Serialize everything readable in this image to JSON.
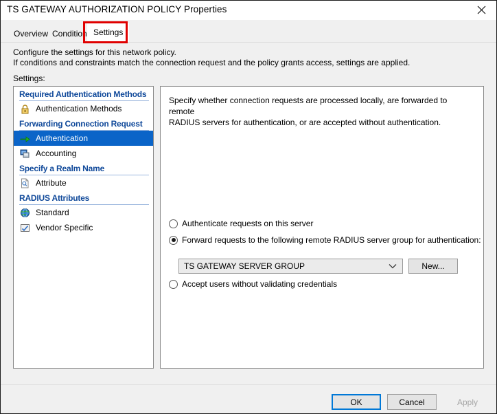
{
  "window": {
    "title": "TS GATEWAY AUTHORIZATION POLICY Properties",
    "close_icon": "close-icon"
  },
  "tabs": [
    {
      "label": "Overview",
      "active": false
    },
    {
      "label": "Conditions",
      "active": false
    },
    {
      "label": "Settings",
      "active": true
    }
  ],
  "description": {
    "line1": "Configure the settings for this network policy.",
    "line2": "If conditions and constraints match the connection request and the policy grants access, settings are applied.",
    "settings_label": "Settings:"
  },
  "settings_tree": {
    "groups": [
      {
        "header": "Required Authentication Methods",
        "items": [
          {
            "label": "Authentication Methods",
            "icon": "padlock-icon",
            "selected": false
          }
        ]
      },
      {
        "header": "Forwarding Connection Request",
        "items": [
          {
            "label": "Authentication",
            "icon": "green-arrow-icon",
            "selected": true
          },
          {
            "label": "Accounting",
            "icon": "computer-icon",
            "selected": false
          }
        ]
      },
      {
        "header": "Specify a Realm Name",
        "items": [
          {
            "label": "Attribute",
            "icon": "document-search-icon",
            "selected": false
          }
        ]
      },
      {
        "header": "RADIUS Attributes",
        "items": [
          {
            "label": "Standard",
            "icon": "globe-icon",
            "selected": false
          },
          {
            "label": "Vendor Specific",
            "icon": "form-check-icon",
            "selected": false
          }
        ]
      }
    ]
  },
  "content": {
    "description_line1": "Specify whether connection requests are processed locally, are forwarded to remote",
    "description_line2": "RADIUS servers for authentication, or are accepted without authentication.",
    "options": [
      {
        "label": "Authenticate requests on this server",
        "checked": false
      },
      {
        "label": "Forward requests to the following remote RADIUS server group for authentication:",
        "checked": true
      },
      {
        "label": "Accept users without validating credentials",
        "checked": false
      }
    ],
    "server_group": {
      "selected": "TS GATEWAY SERVER GROUP",
      "dropdown_icon": "chevron-down-icon"
    },
    "new_button": "New..."
  },
  "footer": {
    "ok": "OK",
    "cancel": "Cancel",
    "apply": "Apply"
  },
  "annotation": {
    "highlight_color": "#e00000",
    "highlight_target": "Settings"
  }
}
